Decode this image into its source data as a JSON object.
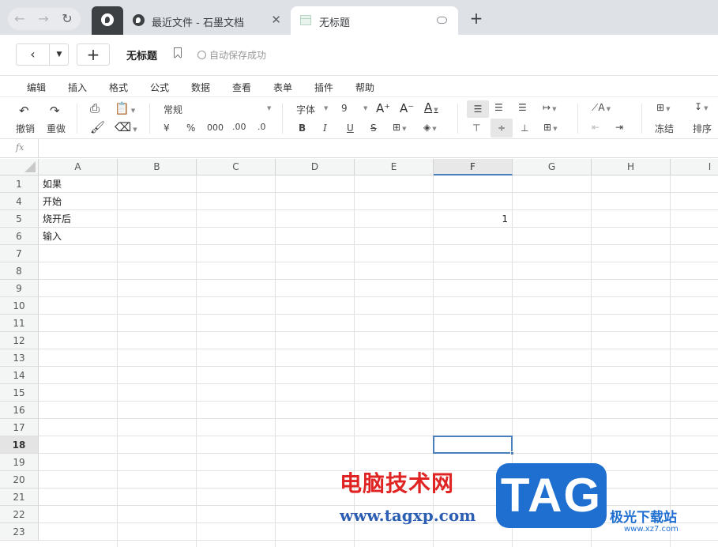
{
  "browser": {
    "tabs": [
      {
        "title": "最近文件 - 石墨文档"
      },
      {
        "title": "无标题"
      }
    ]
  },
  "header": {
    "doc_title": "无标题",
    "save_status": "自动保存成功"
  },
  "menu": [
    "编辑",
    "插入",
    "格式",
    "公式",
    "数据",
    "查看",
    "表单",
    "插件",
    "帮助"
  ],
  "toolbar": {
    "undo": "撤销",
    "redo": "重做",
    "number_format": "常规",
    "currency": "¥",
    "percent": "%",
    "thousands": "000",
    "dec_decrease": ".00",
    "dec_increase": ".0",
    "font": "字体",
    "font_size": "9",
    "freeze": "冻结",
    "sort": "排序"
  },
  "formula_bar": {
    "label": "fx",
    "value": ""
  },
  "grid": {
    "columns": [
      "A",
      "B",
      "C",
      "D",
      "E",
      "F",
      "G",
      "H",
      "I"
    ],
    "selected_column": "F",
    "rows": [
      "1",
      "4",
      "5",
      "6",
      "7",
      "8",
      "9",
      "10",
      "11",
      "12",
      "13",
      "14",
      "15",
      "16",
      "17",
      "18",
      "19",
      "20",
      "21",
      "22",
      "23"
    ],
    "selected_row": "18",
    "selected_cell": "F18",
    "cells": [
      {
        "ref": "A1",
        "value": "如果"
      },
      {
        "ref": "A4",
        "value": "开始"
      },
      {
        "ref": "A5",
        "value": "烧开后"
      },
      {
        "ref": "F5",
        "value": "1"
      },
      {
        "ref": "A6",
        "value": "输入"
      }
    ]
  },
  "watermark": {
    "title": "电脑技术网",
    "url": "www.tagxp.com",
    "badge": "TAG",
    "site": "极光下载站",
    "site_url": "www.xz7.com"
  }
}
